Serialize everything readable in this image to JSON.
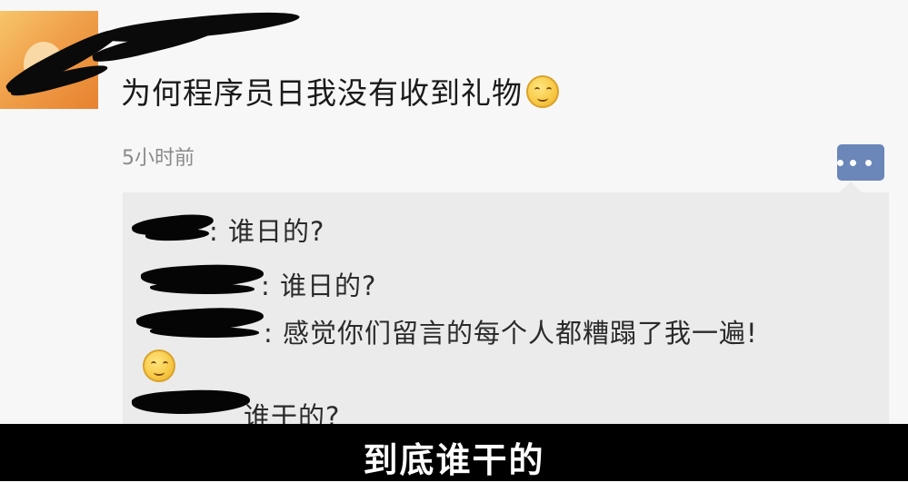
{
  "post": {
    "text": "为何程序员日我没有收到礼物",
    "emoji": "smile-emoji",
    "time": "5小时前"
  },
  "comments": [
    {
      "text": ": 谁日的?"
    },
    {
      "text": ": 谁日的?"
    },
    {
      "text": ": 感觉你们留言的每个人都糟蹋了我一遍!"
    },
    {
      "text": "谁干的?"
    }
  ],
  "caption": "到底谁干的",
  "colors": {
    "comment_button": "#6b86b8",
    "comment_bg": "#ebebeb",
    "caption_bar": "#000000"
  }
}
